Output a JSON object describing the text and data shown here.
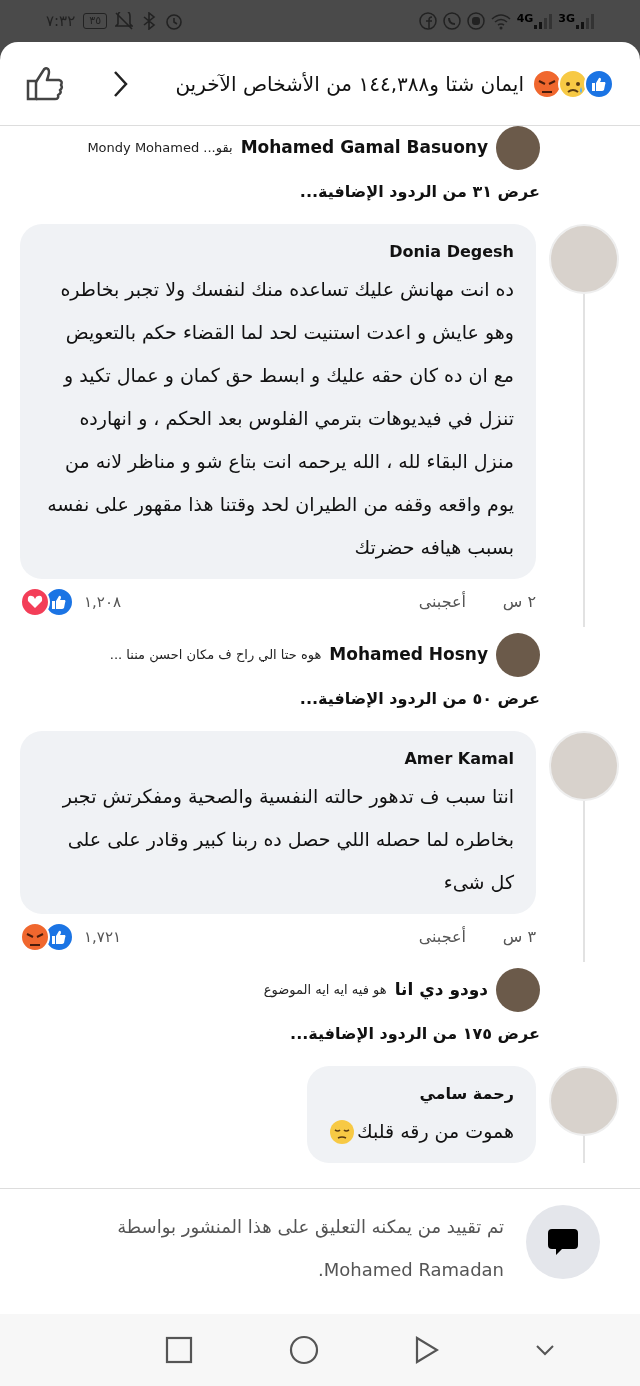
{
  "status_bar": {
    "time": "٧:٣٢",
    "battery": "٣٥",
    "network_labels": [
      "3G",
      "4G"
    ]
  },
  "header": {
    "reactions": [
      {
        "kind": "like"
      },
      {
        "kind": "sad"
      },
      {
        "kind": "angry"
      }
    ],
    "title": "ايمان شتا و١٤٤,٣٨٨ من الأشخاص الآخرين"
  },
  "thread": [
    {
      "kind": "reply",
      "author": "Mohamed Gamal Basuony",
      "text": "بقو... Mondy Mohamed"
    },
    {
      "kind": "more",
      "text": "عرض ٣١ من الردود الإضافية..."
    },
    {
      "kind": "comment",
      "author": "Donia Degesh",
      "text": "ده انت مهانش عليك تساعده منك لنفسك ولا تجبر بخاطره وهو عايش و اعدت استنيت لحد لما القضاء حكم بالتعويض مع ان ده كان حقه عليك و ابسط حق كمان و عمال تكيد و\nتنزل في فيديوهات بترمي الفلوس بعد الحكم ،  و انهارده منزل البقاء لله ، الله يرحمه انت بتاع شو و مناظر لانه من يوم واقعه وقفه من الطيران لحد وقتنا هذا مقهور على نفسه بسبب هيافه حضرتك",
      "time": "٢ س",
      "like_label": "أعجبنى",
      "reactions": [
        {
          "kind": "like"
        },
        {
          "kind": "love"
        }
      ],
      "reaction_count": "١,٢٠٨"
    },
    {
      "kind": "reply",
      "author": "Mohamed Hosny",
      "text": "هوه حتا الي راح ف مكان احسن مننا ..."
    },
    {
      "kind": "more",
      "text": "عرض ٥٠ من الردود الإضافية..."
    },
    {
      "kind": "comment",
      "author": "Amer Kamal",
      "text": "انتا سبب ف تدهور حالته النفسية والصحية ومفكرتش تجبر بخاطره لما حصله اللي حصل ده ربنا كبير وقادر على على كل شىء",
      "time": "٣ س",
      "like_label": "أعجبنى",
      "reactions": [
        {
          "kind": "like"
        },
        {
          "kind": "angry"
        }
      ],
      "reaction_count": "١,٧٢١"
    },
    {
      "kind": "reply",
      "author": "دودو دي انا",
      "text": "هو فيه ايه ايه الموضوع"
    },
    {
      "kind": "more",
      "text": "عرض ١٧٥ من الردود الإضافية..."
    },
    {
      "kind": "comment",
      "author": "رحمة سامي",
      "text": "هموت من رقه قلبك",
      "emoji": {
        "kind": "pensive"
      }
    }
  ],
  "restriction_notice": "تم تقييد من يمكنه التعليق على هذا المنشور بواسطة Mohamed Ramadan."
}
